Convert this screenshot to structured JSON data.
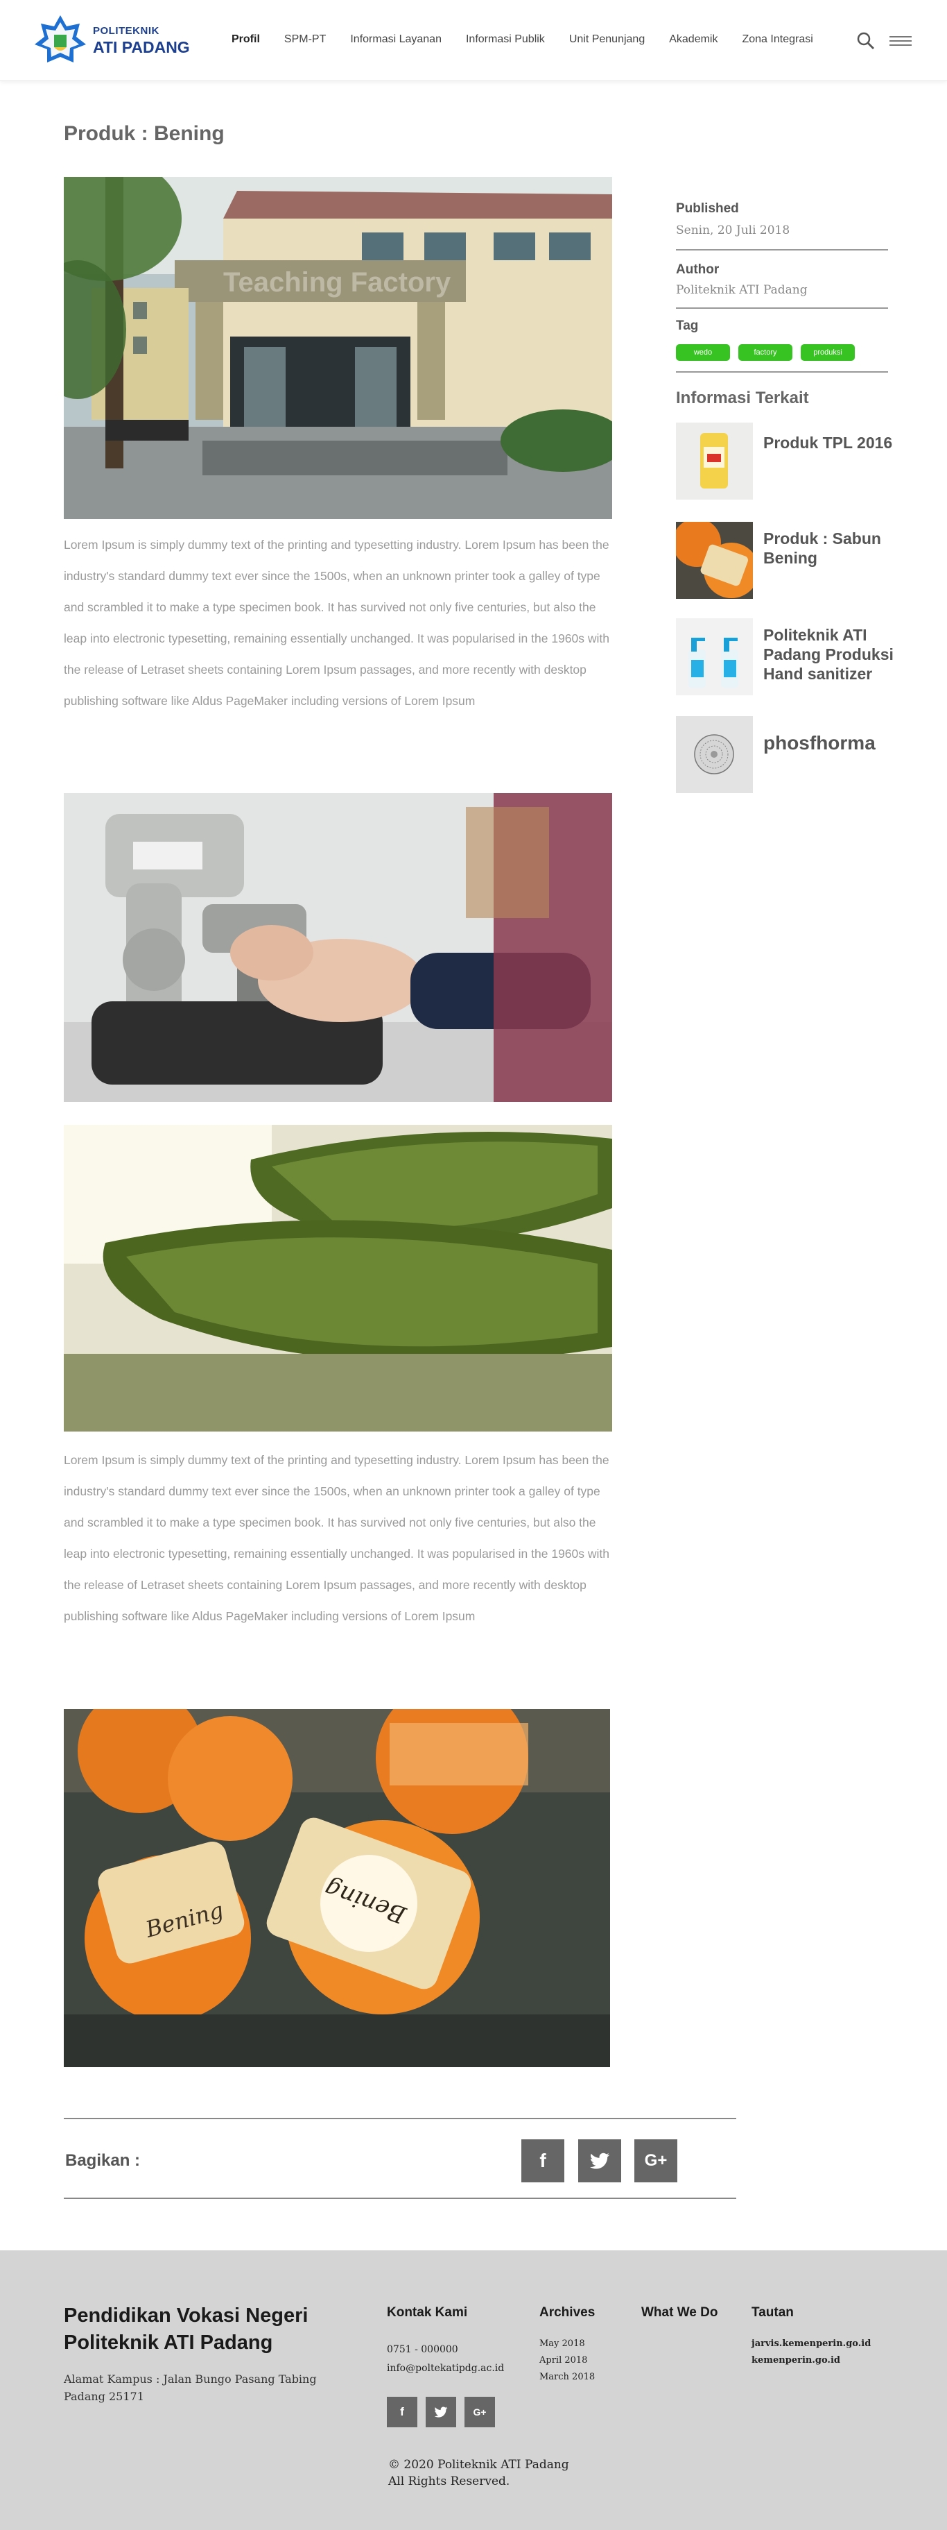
{
  "header": {
    "brand_line1": "POLITEKNIK",
    "brand_line2": "ATI PADANG",
    "nav": [
      "Profil",
      "SPM-PT",
      "Informasi Layanan",
      "Informasi Publik",
      "Unit Penunjang",
      "Akademik",
      "Zona Integrasi"
    ],
    "active_nav": "Profil",
    "icons": {
      "search": "search-icon",
      "menu": "hamburger-menu-icon"
    }
  },
  "article": {
    "title": "Produk : Bening",
    "hero_sign": "Teaching Factory",
    "paragraph1": "Lorem Ipsum is simply dummy text of the printing and typesetting industry. Lorem Ipsum has been the industry's standard dummy text ever since the 1500s, when an unknown printer took a galley of type and scrambled it to make a type specimen book. It has survived not only five centuries, but also the leap into electronic typesetting, remaining essentially unchanged. It was popularised in the 1960s with the release of Letraset sheets containing Lorem Ipsum passages, and more recently with desktop publishing software like Aldus PageMaker including versions of Lorem Ipsum",
    "paragraph2": "Lorem Ipsum is simply dummy text of the printing and typesetting industry. Lorem Ipsum has been the industry's standard dummy text ever since the 1500s, when an unknown printer took a galley of type and scrambled it to make a type specimen book. It has survived not only five centuries, but also the leap into electronic typesetting, remaining essentially unchanged. It was popularised in the 1960s with the release of Letraset sheets containing Lorem Ipsum passages, and more recently with desktop publishing software like Aldus PageMaker including versions of Lorem Ipsum",
    "soap_brand": "Bening"
  },
  "sidebar": {
    "published_label": "Published",
    "published_value": "Senin, 20 Juli 2018",
    "author_label": "Author",
    "author_value": "Politeknik ATI Padang",
    "tag_label": "Tag",
    "tags": [
      "wedo",
      "factory",
      "produksi"
    ],
    "related_heading": "Informasi Terkait",
    "related": [
      {
        "title": "Produk TPL 2016"
      },
      {
        "title": "Produk : Sabun Bening"
      },
      {
        "title": "Politeknik ATI Padang Produksi Hand sanitizer"
      },
      {
        "title": "phosfhorma"
      }
    ],
    "tag_color": "#37c322"
  },
  "share": {
    "label": "Bagikan :",
    "buttons": [
      "f",
      "twitter",
      "G+"
    ]
  },
  "footer": {
    "title": "Pendidikan Vokasi Negeri Politeknik ATI Padang",
    "address": "Alamat Kampus : Jalan Bungo Pasang Tabing Padang 25171",
    "contact_heading": "Kontak Kami",
    "phone": "0751 - 000000",
    "email": "info@poltekatipdg.ac.id",
    "archives_heading": "Archives",
    "archives": [
      "May 2018",
      "April 2018",
      "March 2018"
    ],
    "whatwedo_heading": "What We Do",
    "links_heading": "Tautan",
    "links": [
      "jarvis.kemenperin.go.id",
      "kemenperin.go.id"
    ],
    "social": [
      "f",
      "twitter",
      "G+"
    ],
    "copyright_line1": "© 2020 Politeknik ATI Padang",
    "copyright_line2": "All Rights Reserved."
  }
}
